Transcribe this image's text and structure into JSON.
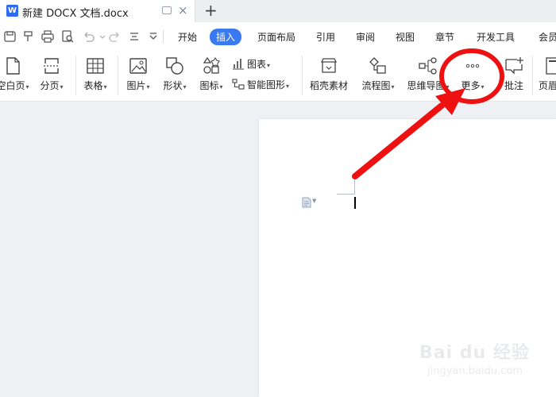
{
  "titlebar": {
    "app_badge": "W",
    "doc_title": "新建 DOCX 文档.docx",
    "close_glyph": "×",
    "new_tab_glyph": "+"
  },
  "menu": {
    "items": [
      "开始",
      "插入",
      "页面布局",
      "引用",
      "审阅",
      "视图",
      "章节",
      "开发工具",
      "会员"
    ],
    "active": "插入"
  },
  "ribbon": {
    "blank_page": "空白页",
    "page_break": "分页",
    "table": "表格",
    "picture": "图片",
    "shape": "形状",
    "icons": "图标",
    "chart": "图表",
    "smart_art": "智能图形",
    "material": "稻壳素材",
    "flowchart": "流程图",
    "mindmap": "思维导图",
    "more": "更多",
    "comment": "批注",
    "header": "页眉"
  },
  "annotation": {
    "color": "#ee1111"
  },
  "watermark": {
    "brand": "Bai du 经验",
    "site": "jingyan.baidu.com"
  }
}
